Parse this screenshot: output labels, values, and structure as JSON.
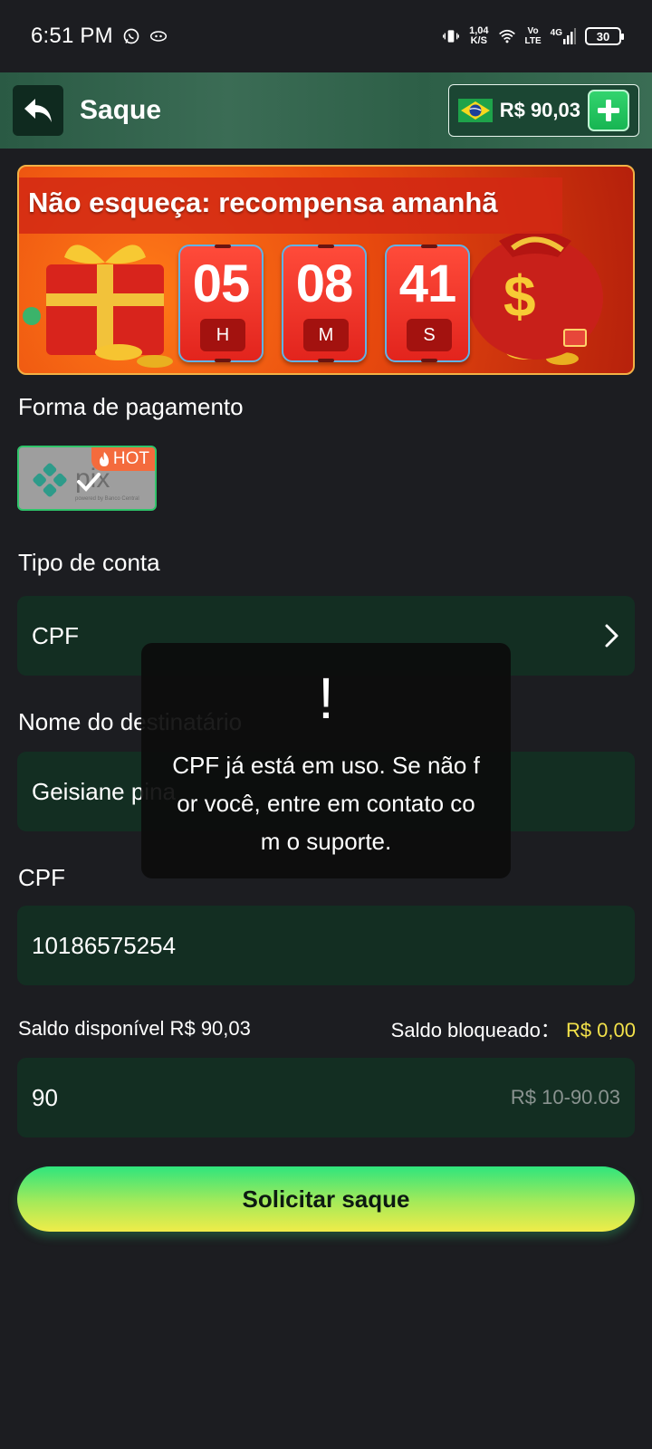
{
  "status_bar": {
    "time": "6:51 PM",
    "net_speed_value": "1,04",
    "net_speed_unit": "K/S",
    "volte_top": "Vo",
    "volte_bottom": "LTE",
    "network": "4G",
    "battery": "30"
  },
  "header": {
    "title": "Saque",
    "balance": "R$ 90,03"
  },
  "banner": {
    "title": "Não esqueça: recompensa amanhã",
    "timer": [
      {
        "value": "05",
        "unit": "H"
      },
      {
        "value": "08",
        "unit": "M"
      },
      {
        "value": "41",
        "unit": "S"
      }
    ]
  },
  "payment": {
    "label": "Forma de pagamento",
    "method_logo_text": "pix",
    "method_logo_sub": "powered by Banco Central",
    "hot_label": "HOT"
  },
  "account_type": {
    "label": "Tipo de conta",
    "value": "CPF"
  },
  "recipient": {
    "label": "Nome do destinatário",
    "value": "Geisiane pina"
  },
  "cpf": {
    "label": "CPF",
    "value": "10186575254"
  },
  "balance": {
    "available_label": "Saldo disponível R$",
    "available_value": "90,03",
    "blocked_label": "Saldo bloqueado：",
    "blocked_value": "R$ 0,00"
  },
  "amount": {
    "value": "90",
    "placeholder": "R$ 10-90.03"
  },
  "submit_label": "Solicitar saque",
  "toast": {
    "icon": "!",
    "message": "CPF já está em uso. Se não for você, entre em contato com o suporte."
  },
  "colors": {
    "background": "#1c1d21",
    "field": "#132e22",
    "header": "#2d5f47",
    "accent_green": "#2fe57d",
    "accent_yellow": "#f2e14a"
  }
}
